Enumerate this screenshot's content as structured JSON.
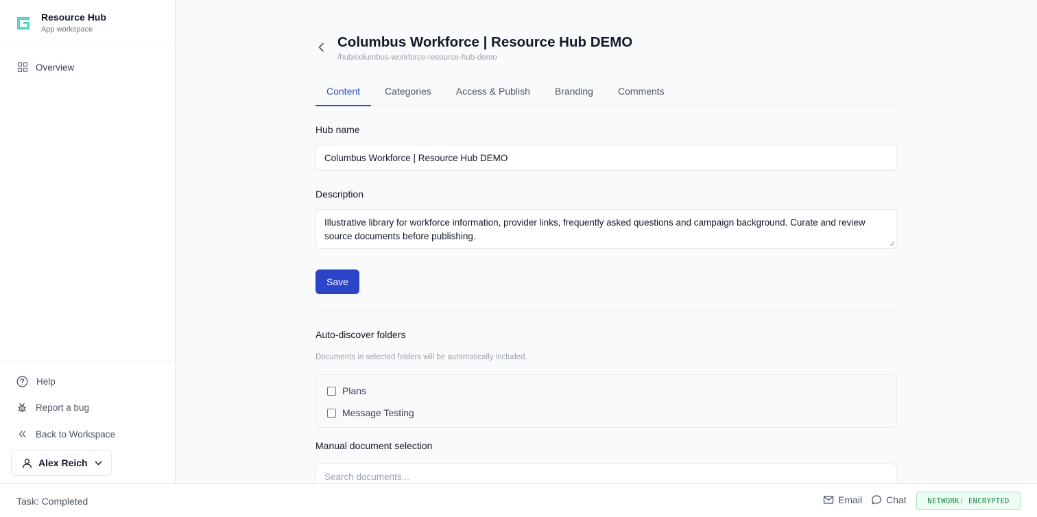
{
  "brand": {
    "title": "Resource Hub",
    "subtitle": "App workspace",
    "logo_color": "#4fd1c5"
  },
  "sidebar": {
    "items": [
      {
        "label": "Overview",
        "icon": "grid-icon"
      }
    ],
    "bottom_links": [
      {
        "label": "Help",
        "icon": "help-circle-icon"
      },
      {
        "label": "Report a bug",
        "icon": "bug-icon"
      },
      {
        "label": "Back to Workspace",
        "icon": "chevrons-left-icon"
      }
    ],
    "user": {
      "name": "Alex Reich",
      "icon": "user-icon"
    }
  },
  "header": {
    "title": "Columbus Workforce | Resource Hub DEMO",
    "path": "/hub/columbus-workforce-resource-hub-demo"
  },
  "tabs": [
    {
      "label": "Content",
      "active": true
    },
    {
      "label": "Categories",
      "active": false
    },
    {
      "label": "Access & Publish",
      "active": false
    },
    {
      "label": "Branding",
      "active": false
    },
    {
      "label": "Comments",
      "active": false
    }
  ],
  "form": {
    "hub_name_label": "Hub name",
    "hub_name_value": "Columbus Workforce | Resource Hub DEMO",
    "description_label": "Description",
    "description_value": "Illustrative library for workforce information, provider links, frequently asked questions and campaign background. Curate and review source documents before publishing.",
    "save_label": "Save"
  },
  "auto_discover": {
    "title": "Auto-discover folders",
    "hint": "Documents in selected folders will be automatically included.",
    "folders": [
      {
        "label": "Plans",
        "checked": false
      },
      {
        "label": "Message Testing",
        "checked": false
      }
    ]
  },
  "manual": {
    "title": "Manual document selection",
    "search_placeholder": "Search documents..."
  },
  "footer": {
    "task_status": "Task: Completed",
    "email_label": "Email",
    "chat_label": "Chat",
    "network_badge": "NETWORK: ENCRYPTED"
  },
  "colors": {
    "accent": "#2b45c8",
    "tab_active": "#2b4fc7",
    "badge_green": "#15803d"
  }
}
